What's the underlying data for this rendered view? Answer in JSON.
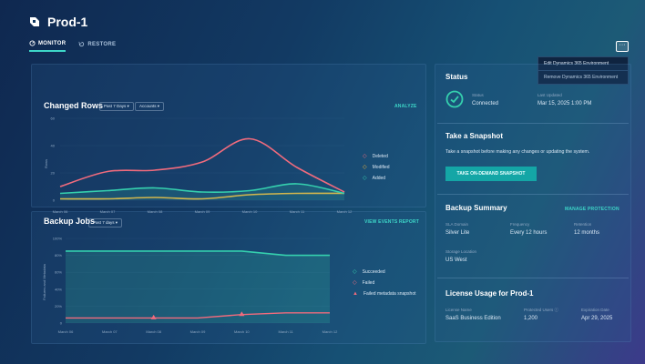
{
  "app": {
    "title": "Prod-1"
  },
  "tabs": [
    {
      "label": "MONITOR"
    },
    {
      "label": "RESTORE"
    }
  ],
  "menu": {
    "button_label": "···",
    "items": [
      "Edit Dynamics 365 Environment",
      "Remove Dynamics 365 Environment"
    ]
  },
  "changed_rows": {
    "title": "Changed Rows",
    "filter_period": "Past 7 Days",
    "filter_entity": "Accounts",
    "action": "ANALYZE",
    "ylabel": "Rows",
    "legend": [
      "Deleted",
      "Modified",
      "Added"
    ],
    "colors": {
      "deleted": "#f06b7d",
      "modified": "#f0b33b",
      "added": "#35d0ae"
    }
  },
  "backup_jobs": {
    "title": "Backup Jobs",
    "filter_period": "Past 7 days",
    "action": "VIEW EVENTS REPORT",
    "ylabel": "Failures and Metadata",
    "legend": [
      "Succeeded",
      "Failed",
      "Failed metadata snapshot"
    ],
    "colors": {
      "succeeded": "#35d0ae",
      "failed": "#f06b7d",
      "snapshot": "#f06b7d"
    }
  },
  "chart_data": [
    {
      "type": "line",
      "title": "Changed Rows",
      "ylabel": "Rows",
      "x": [
        "March 06",
        "March 07",
        "March 08",
        "March 09",
        "March 10",
        "March 11",
        "March 12"
      ],
      "yticks": [
        0,
        20,
        40,
        60
      ],
      "ylim": [
        0,
        60
      ],
      "series": [
        {
          "name": "Deleted",
          "values": [
            10,
            21,
            22,
            28,
            45,
            24,
            6
          ]
        },
        {
          "name": "Modified",
          "values": [
            1,
            1,
            2,
            1,
            4,
            5,
            5
          ]
        },
        {
          "name": "Added",
          "values": [
            5,
            7,
            9,
            6,
            7,
            12,
            5
          ]
        }
      ]
    },
    {
      "type": "line",
      "title": "Backup Jobs",
      "ylabel": "Failures and Metadata",
      "x": [
        "March 06",
        "March 07",
        "March 08",
        "March 09",
        "March 10",
        "March 11",
        "March 12"
      ],
      "yticks": [
        "0",
        "20%",
        "40%",
        "60%",
        "80%",
        "100%"
      ],
      "ylim": [
        0,
        100
      ],
      "series": [
        {
          "name": "Succeeded",
          "values": [
            85,
            85,
            85,
            85,
            85,
            80,
            80
          ]
        },
        {
          "name": "Failed",
          "values": [
            6,
            6,
            6,
            6,
            10,
            12,
            12
          ]
        },
        {
          "name": "Failed metadata snapshot",
          "markers": [
            "March 08",
            "March 10"
          ]
        }
      ]
    }
  ],
  "status": {
    "title": "Status",
    "status_label": "Status",
    "status_value": "Connected",
    "updated_label": "Last Updated",
    "updated_value": "Mar 15, 2025 1:00 PM"
  },
  "snapshot": {
    "title": "Take a Snapshot",
    "description": "Take a snapshot before making any changes or updating the system.",
    "button": "TAKE ON-DEMAND SNAPSHOT"
  },
  "backup_summary": {
    "title": "Backup Summary",
    "action": "MANAGE PROTECTION",
    "sla_label": "SLA Domain",
    "sla_value": "Silver Lite",
    "freq_label": "Frequency",
    "freq_value": "Every 12 hours",
    "ret_label": "Retention",
    "ret_value": "12 months",
    "loc_label": "Storage Location",
    "loc_value": "US West"
  },
  "license": {
    "title": "License Usage for Prod-1",
    "name_label": "License Name",
    "name_value": "SaaS Business Edition",
    "users_label": "Protected Users",
    "users_value": "1,200",
    "exp_label": "Expiration Date",
    "exp_value": "Apr 29, 2025"
  }
}
